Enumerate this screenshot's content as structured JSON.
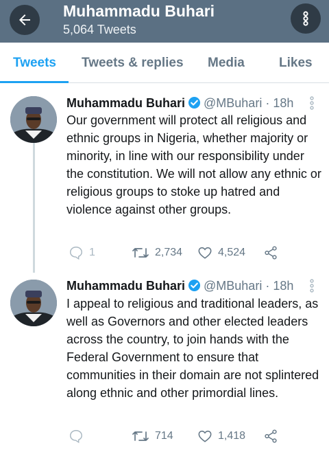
{
  "header": {
    "name": "Muhammadu Buhari",
    "tweet_count": "5,064 Tweets",
    "back_icon": "arrow-left-icon",
    "more_icon": "vertical-dots-icon"
  },
  "tabs": [
    {
      "label": "Tweets",
      "active": true
    },
    {
      "label": "Tweets & replies",
      "active": false
    },
    {
      "label": "Media",
      "active": false
    },
    {
      "label": "Likes",
      "active": false
    }
  ],
  "colors": {
    "header_bg": "#5b7083",
    "accent": "#1da1f2",
    "secondary_text": "#657786"
  },
  "tweets": [
    {
      "author": "Muhammadu Buhari",
      "handle": "@MBuhari",
      "sep": "·",
      "time": "18h",
      "text": "Our government will protect all religious and ethnic groups in Nigeria, whether majority or minority, in line with our responsibility under the constitution. We will not allow any ethnic or religious groups to stoke up hatred and violence against other groups.",
      "replies": "1",
      "retweets": "2,734",
      "likes": "4,524"
    },
    {
      "author": "Muhammadu Buhari",
      "handle": "@MBuhari",
      "sep": "·",
      "time": "18h",
      "text": "I appeal to religious and traditional leaders, as well as Governors and other elected leaders across the country, to join hands with the Federal Government to ensure that communities in their domain are not splintered along ethnic and other primordial lines.",
      "replies": "",
      "retweets": "714",
      "likes": "1,418"
    }
  ]
}
